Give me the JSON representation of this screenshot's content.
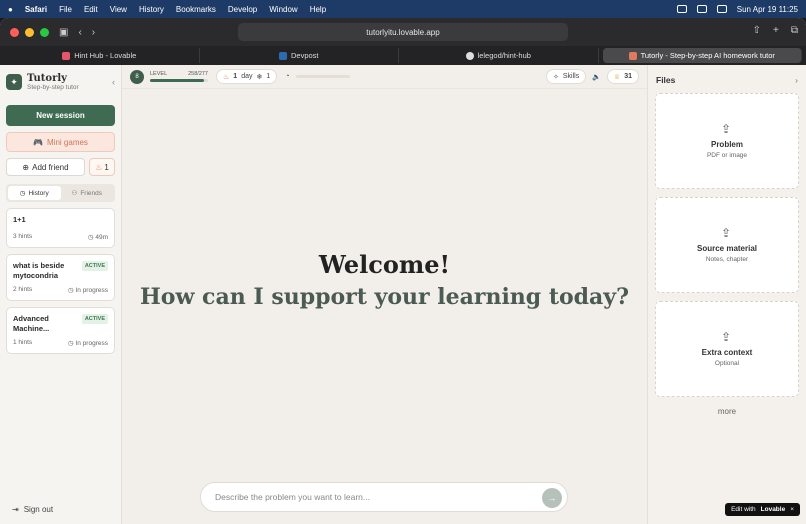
{
  "menubar": {
    "app": "Safari",
    "items": [
      "File",
      "Edit",
      "View",
      "History",
      "Bookmarks",
      "Develop",
      "Window",
      "Help"
    ],
    "clock": "Sun Apr 19  11:25"
  },
  "browser": {
    "url": "tutorlyitu.lovable.app",
    "tabs": [
      {
        "label": "Hint Hub - Lovable",
        "color": "#e5566a"
      },
      {
        "label": "Devpost",
        "color": "#2b6cb0"
      },
      {
        "label": "lelegod/hint-hub",
        "color": "#dddddd"
      },
      {
        "label": "Tutorly - Step-by-step AI homework tutor",
        "color": "#e07a5f"
      }
    ]
  },
  "sidebar": {
    "brand": "Tutorly",
    "tagline": "Step-by-step tutor",
    "new_session": "New session",
    "mini_games": "Mini games",
    "add_friend": "Add friend",
    "streak": "1",
    "tab_history": "History",
    "tab_friends": "Friends",
    "sessions": [
      {
        "title": "1+1",
        "badge": "",
        "hints": "3 hints",
        "status": "49m"
      },
      {
        "title": "what is beside mytocondria",
        "badge": "ACTIVE",
        "hints": "2 hints",
        "status": "In progress"
      },
      {
        "title": "Advanced Machine...",
        "badge": "ACTIVE",
        "hints": "1 hints",
        "status": "In progress"
      }
    ],
    "sign_out": "Sign out"
  },
  "topbar": {
    "level_num": "8",
    "level_label": "LEVEL",
    "level_xp": "258/277",
    "level_progress": 0.93,
    "streak_days": "1",
    "streak_unit": "day",
    "freeze": "1",
    "skills": "Skills",
    "trophies": "31"
  },
  "main": {
    "welcome": "Welcome!",
    "subtitle": "How can I support your learning today?",
    "input_placeholder": "Describe the problem you want to learn..."
  },
  "files": {
    "title": "Files",
    "slots": [
      {
        "name": "Problem",
        "desc": "PDF or image"
      },
      {
        "name": "Source material",
        "desc": "Notes, chapter"
      },
      {
        "name": "Extra context",
        "desc": "Optional"
      }
    ],
    "more": "more"
  },
  "badge": {
    "prefix": "Edit with",
    "brand": "Lovable"
  }
}
